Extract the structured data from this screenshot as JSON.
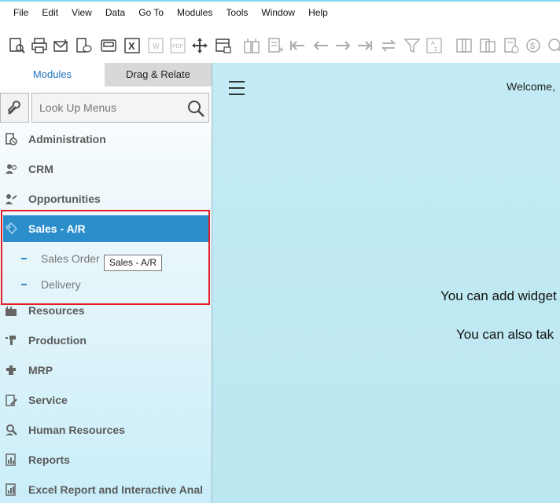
{
  "menu": [
    "File",
    "Edit",
    "View",
    "Data",
    "Go To",
    "Modules",
    "Tools",
    "Window",
    "Help"
  ],
  "toolbar_icons": [
    "preview-icon",
    "print-icon",
    "email-icon",
    "sms-icon",
    "fax-icon",
    "export-excel-icon",
    "export-word-icon",
    "export-pdf-icon",
    "move-icon",
    "lock-layout-icon",
    "base-document-icon",
    "target-document-icon",
    "first-record-icon",
    "previous-record-icon",
    "next-record-icon",
    "last-record-icon",
    "refresh-icon",
    "filter-icon",
    "sort-icon",
    "settings-icon",
    "copy-icon",
    "journal-icon",
    "payment-icon",
    "gross-profit-icon"
  ],
  "sidebar": {
    "tabs": {
      "modules": "Modules",
      "drag_relate": "Drag & Relate"
    },
    "search_placeholder": "Look Up Menus",
    "items": [
      {
        "label": "Administration",
        "icon": "administration-icon"
      },
      {
        "label": "CRM",
        "icon": "crm-icon"
      },
      {
        "label": "Opportunities",
        "icon": "opportunities-icon"
      },
      {
        "label": "Sales - A/R",
        "icon": "sales-icon"
      },
      {
        "label": "Resources",
        "icon": "resources-icon"
      },
      {
        "label": "Production",
        "icon": "production-icon"
      },
      {
        "label": "MRP",
        "icon": "mrp-icon"
      },
      {
        "label": "Service",
        "icon": "service-icon"
      },
      {
        "label": "Human Resources",
        "icon": "human-resources-icon"
      },
      {
        "label": "Reports",
        "icon": "reports-icon"
      },
      {
        "label": "Excel Report and Interactive Anal",
        "icon": "excel-report-icon"
      }
    ],
    "sub_items": [
      {
        "label": "Sales Order"
      },
      {
        "label": "Delivery"
      }
    ],
    "tooltip": "Sales - A/R"
  },
  "main": {
    "welcome": "Welcome,",
    "message1": "You can add widget",
    "message2": "You can also tak"
  },
  "colors": {
    "selected": "#2b8ecb",
    "highlight": "#e01e24",
    "main_bg": "#c2ebf5"
  }
}
